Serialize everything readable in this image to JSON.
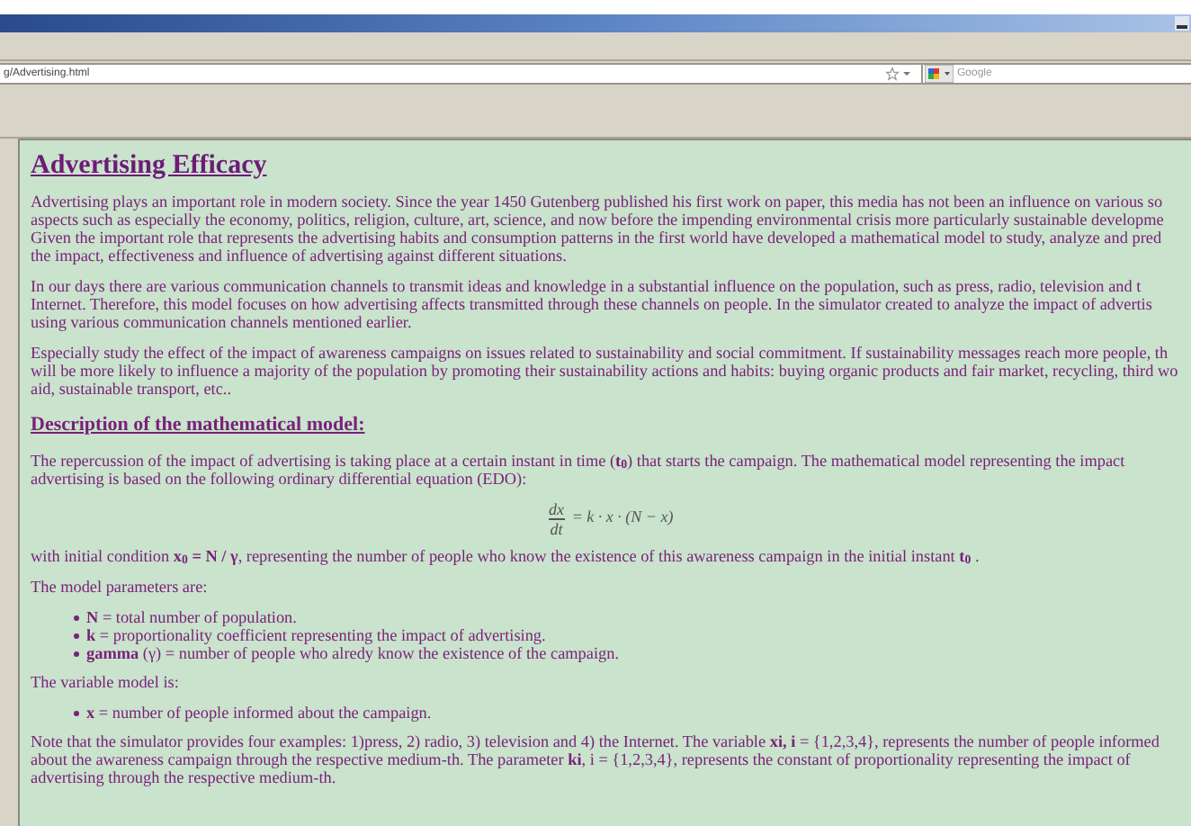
{
  "browser": {
    "address": "g/Advertising.html",
    "search_placeholder": "Google"
  },
  "page": {
    "title": "Advertising Efficacy",
    "blocks": [
      {
        "kind": "paragraph",
        "lines": [
          "Advertising plays an important role in modern society. Since the year 1450 Gutenberg published his first work on paper, this media has not been an influence on various so",
          "aspects such as especially the economy, politics, religion, culture, art, science, and now before the impending environmental crisis more particularly sustainable developme",
          "Given the important role that represents the advertising habits and consumption patterns in the first world have developed a mathematical model to study, analyze and pred",
          "the impact, effectiveness and influence of advertising against different situations."
        ]
      },
      {
        "kind": "paragraph",
        "lines": [
          "In our days there are various communication channels to transmit ideas and knowledge in a substantial influence on the population, such as press, radio, television and t",
          "Internet. Therefore, this model focuses on how advertising affects transmitted through these channels on people. In the simulator created to analyze the impact of advertis",
          "using various communication channels mentioned earlier."
        ]
      },
      {
        "kind": "paragraph",
        "lines": [
          "Especially study the effect of the impact of awareness campaigns on issues related to sustainability and social commitment. If sustainability messages reach more people, th",
          "will be more likely to influence a majority of the population by promoting their sustainability actions and habits: buying organic products and fair market, recycling, third wo",
          "aid, sustainable transport, etc.."
        ]
      },
      {
        "kind": "heading",
        "text": "Description of the mathematical model:"
      },
      {
        "kind": "paragraph",
        "lines": [
          "The repercussion of the impact of advertising is taking place at a certain instant in time (**t$_{0}$**) that starts the campaign. The mathematical model representing the impact",
          "advertising is based on the following ordinary differential equation (EDO):"
        ]
      },
      {
        "kind": "equation",
        "numerator": "dx",
        "denominator": "dt",
        "rhs": "= k · x · (N − x)"
      },
      {
        "kind": "paragraph",
        "lines": [
          "with initial condition **x$_{0}$ = N / γ**, representing the number of people who know the existence of this awareness campaign in the initial instant **t$_{0}$** ."
        ]
      },
      {
        "kind": "paragraph",
        "lines": [
          "The model parameters are:"
        ]
      },
      {
        "kind": "list",
        "items": [
          "**N** = total number of population.",
          "**k** = proportionality coefficient representing the impact of advertising.",
          "**gamma** (γ) = number of people who alredy know the existence of the campaign."
        ]
      },
      {
        "kind": "paragraph",
        "lines": [
          "The variable model is:"
        ]
      },
      {
        "kind": "list",
        "items": [
          "**x** = number of people informed about the campaign."
        ]
      },
      {
        "kind": "paragraph",
        "lines": [
          "Note that the simulator provides four examples: 1)press, 2) radio, 3) television and 4) the Internet. The variable **xi, i** = {1,2,3,4}, represents the number of people informed",
          "about the awareness campaign through the respective medium-th. The parameter **ki**, i = {1,2,3,4}, represents the constant of proportionality representing the impact of",
          "advertising through the respective medium-th."
        ]
      }
    ]
  }
}
